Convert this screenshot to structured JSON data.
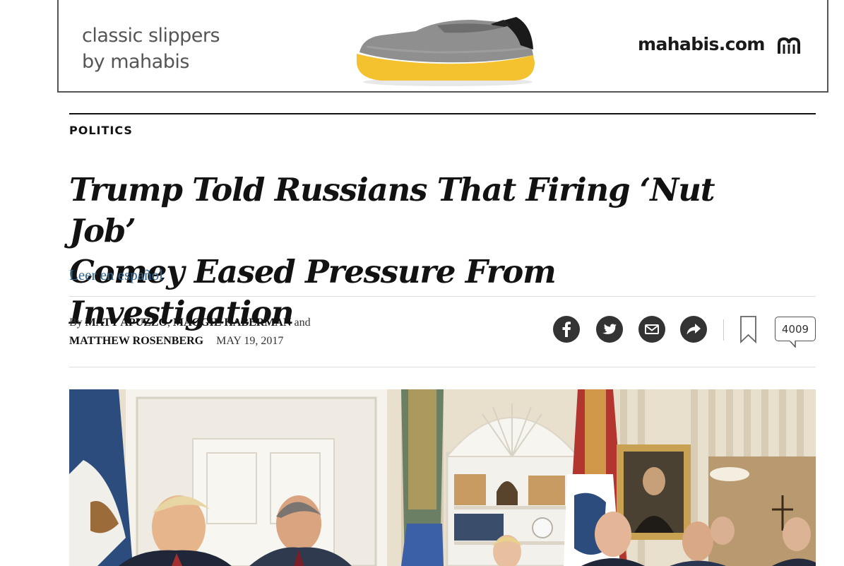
{
  "ad": {
    "tagline_line1": "classic slippers",
    "tagline_line2": "by mahabis",
    "domain": "mahabis.com",
    "product_icon": "felt-slipper",
    "logo_icon": "mahabis-logo",
    "choices_icons": [
      "adchoices-icon",
      "close-icon"
    ]
  },
  "article": {
    "section": "POLITICS",
    "headline_line1": "Trump Told Russians That Firing ‘Nut Job’",
    "headline_line2": "Comey Eased Pressure From Investigation",
    "translation_link": "Leer en español",
    "byline": {
      "prefix": "By",
      "authors": [
        "MATT APUZZO",
        "MAGGIE HABERMAN",
        "MATTHEW ROSENBERG"
      ],
      "separator_comma": ",",
      "conjunction": "and",
      "date": "MAY 19, 2017"
    }
  },
  "share_tools": {
    "icons": [
      "facebook-icon",
      "twitter-icon",
      "email-icon",
      "share-icon",
      "bookmark-icon"
    ],
    "comment_count": "4009"
  },
  "photo": {
    "subject": "oval-office-meeting-photo"
  },
  "colors": {
    "text": "#121212",
    "link": "#326891",
    "share_button": "#333333",
    "rule": "#dddddd",
    "slipper_sole": "#f5c22f",
    "slipper_felt": "#8f8f8f"
  }
}
